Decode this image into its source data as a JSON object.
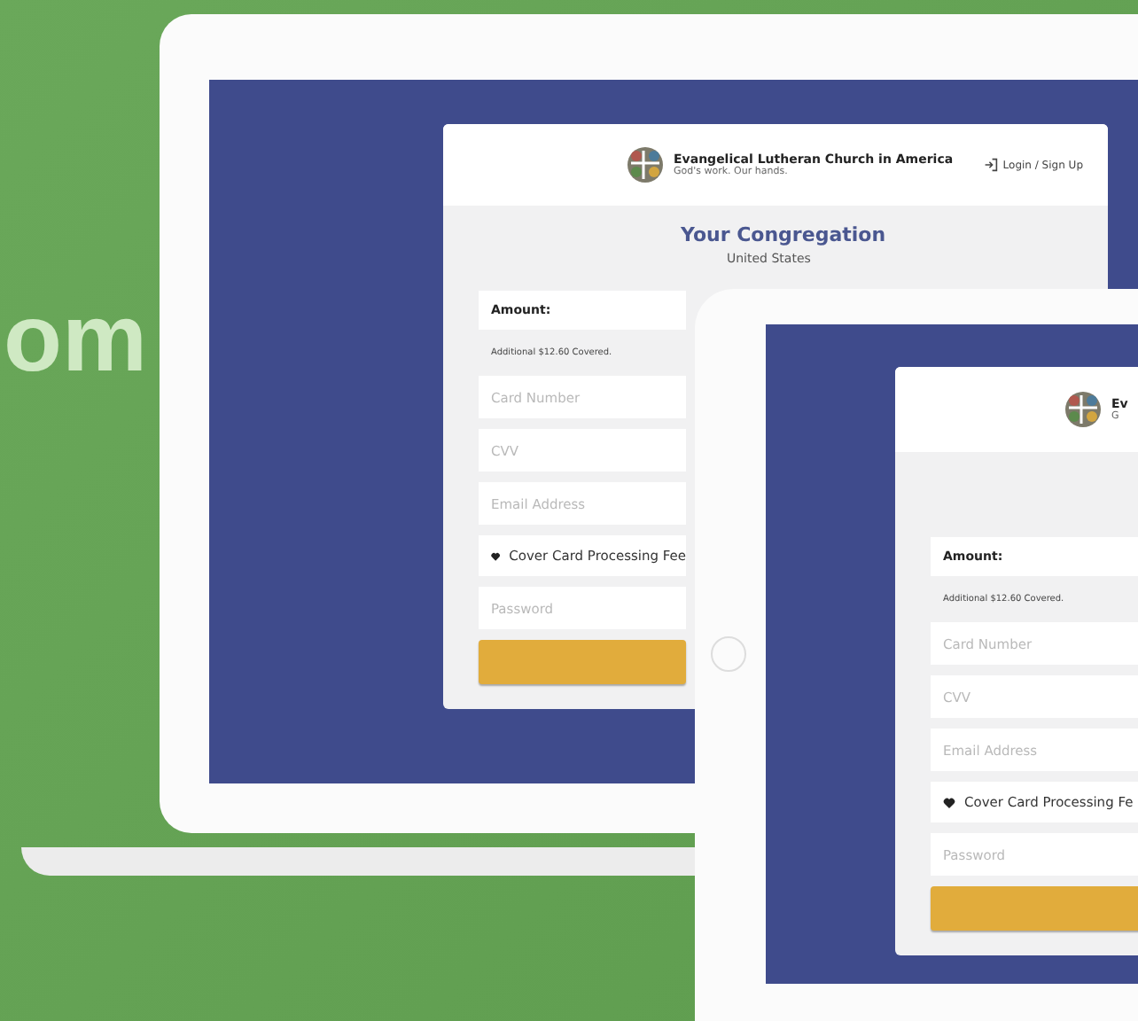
{
  "headline": {
    "text": "om"
  },
  "laptop": {
    "header": {
      "org_name": "Evangelical Lutheran Church in America",
      "tagline": "God's work. Our hands.",
      "login": "Login / Sign Up"
    },
    "title": "Your Congregation",
    "subtitle": "United States",
    "form": {
      "amount_label": "Amount:",
      "note": "Additional $12.60 Covered.",
      "rows": [
        {
          "kind": "input",
          "placeholder": "Card Number"
        },
        {
          "kind": "input",
          "placeholder": "CVV"
        },
        {
          "kind": "input",
          "placeholder": "Email Address"
        },
        {
          "kind": "option",
          "label": "Cover Card Processing Fee"
        },
        {
          "kind": "input",
          "placeholder": "Password"
        },
        {
          "kind": "submit"
        }
      ]
    }
  },
  "tablet": {
    "header": {
      "org_name": "Ev",
      "tagline": "G"
    },
    "form": {
      "amount_label": "Amount:",
      "note": "Additional $12.60 Covered.",
      "rows": [
        {
          "kind": "input",
          "placeholder": "Card Number"
        },
        {
          "kind": "input",
          "placeholder": "CVV"
        },
        {
          "kind": "input",
          "placeholder": "Email Address"
        },
        {
          "kind": "option",
          "label": "Cover Card Processing Fe"
        },
        {
          "kind": "input",
          "placeholder": "Password"
        },
        {
          "kind": "submit"
        }
      ]
    }
  }
}
